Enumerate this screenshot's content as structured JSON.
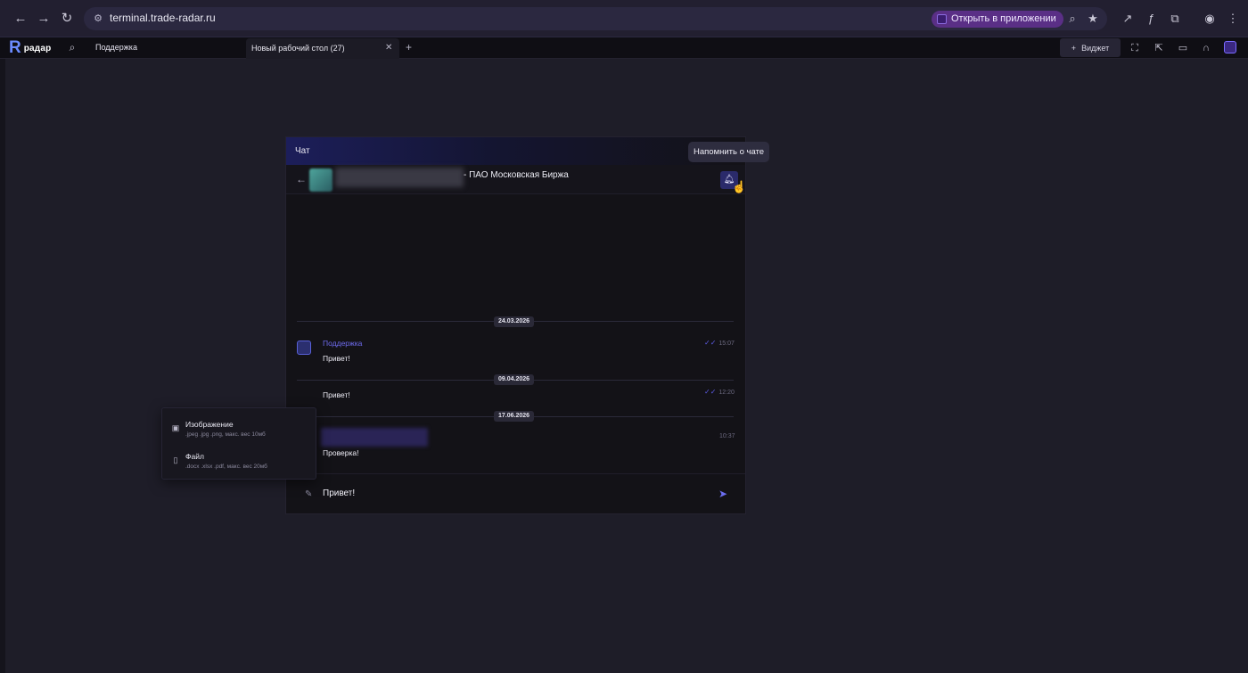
{
  "browser": {
    "url": "terminal.trade-radar.ru",
    "open_in_app": "Открыть в приложении",
    "icons": [
      "back-icon",
      "forward-icon",
      "reload-icon",
      "site-settings-icon",
      "zoom-icon",
      "bookmark-star-icon",
      "extension-pin-icon",
      "formula-icon",
      "extensions-icon",
      "profile-icon",
      "menu-dots-icon"
    ]
  },
  "app": {
    "logo_letter": "R",
    "logo_text": "радар",
    "support": "Поддержка",
    "tab_label": "Новый рабочий стол (27)",
    "widget_label": "Виджет",
    "widget_plus": "+"
  },
  "chat": {
    "title": "Чат",
    "contact_name": "- ПАО Московская Биржа",
    "tooltip": "Напомнить о чате",
    "messages": [
      {
        "date": "24.03.2026",
        "sender": "Поддержка",
        "text": "Привет!",
        "time": "15:07",
        "read": true
      },
      {
        "date": "09.04.2026",
        "text": "Привет!",
        "time": "12:20",
        "read": true
      },
      {
        "date": "17.06.2026",
        "text": "Проверка!",
        "time": "10:37",
        "read": false
      }
    ],
    "input_value": "Привет!"
  },
  "attach_menu": {
    "items": [
      {
        "title": "Изображение",
        "subtitle": ".jpeg .jpg .png, макс. вес 10мб",
        "icon": "image-icon"
      },
      {
        "title": "Файл",
        "subtitle": ".docx .xlsx .pdf, макс. вес 20мб",
        "icon": "file-icon"
      }
    ]
  },
  "colors": {
    "accent": "#6b6ef0",
    "app_bg": "#1e1d28",
    "chat_bg": "#131217"
  }
}
